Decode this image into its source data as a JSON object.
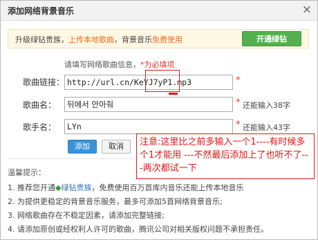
{
  "dialog": {
    "title": "添加网络背景音乐",
    "close_glyph": "×"
  },
  "promo": {
    "text_prefix": "升级绿钻贵族，",
    "upload_link": "上传本地歌曲",
    "text_mid": "，背景音乐",
    "free_link": "免费使用",
    "button_label": "开通绿钻"
  },
  "hint": {
    "text": "请填写网络歌曲信息，",
    "required": "*为必填项"
  },
  "fields": {
    "link_label": "歌曲链接：",
    "link_value": "http://url.cn/KeYJ7yP1.mp3",
    "name_label": "歌曲名：",
    "name_value": "뒤에서 안아줘",
    "name_remaining": "还能输入38字",
    "singer_label": "歌手名：",
    "singer_value": "LYn",
    "singer_remaining": "还能输入43字",
    "required_mark": "*"
  },
  "buttons": {
    "add": "添加",
    "cancel": "取消"
  },
  "tips": {
    "title": "温馨提示：",
    "t1_prefix": "1. 推荐您开通",
    "t1_link": "绿钻贵族",
    "t1_suffix": "，免费使用百万首库内音乐还能上传本地音乐",
    "t2": "2. 为提供更稳定的背景音乐服务，最多可添加5首网络背景音乐;",
    "t3": "3. 网络歌曲存在不稳定因素，请添加完整链接;",
    "t4": "4. 请添加原创或经权利人许可的歌曲，腾讯公司对相关版权问题不承担责任。"
  },
  "annotation": {
    "text": "注意:这里比之前多输入一个1----有时候多个1才能用 ---不然最后添加上了也听不了---两次都试一下"
  },
  "colors": {
    "accent_green": "#52b14e",
    "accent_blue": "#3a93d8",
    "warning_red": "#e01515",
    "promo_orange": "#f26b1d"
  },
  "icons": {
    "close": "close-icon",
    "diamond": "green-diamond-icon"
  }
}
